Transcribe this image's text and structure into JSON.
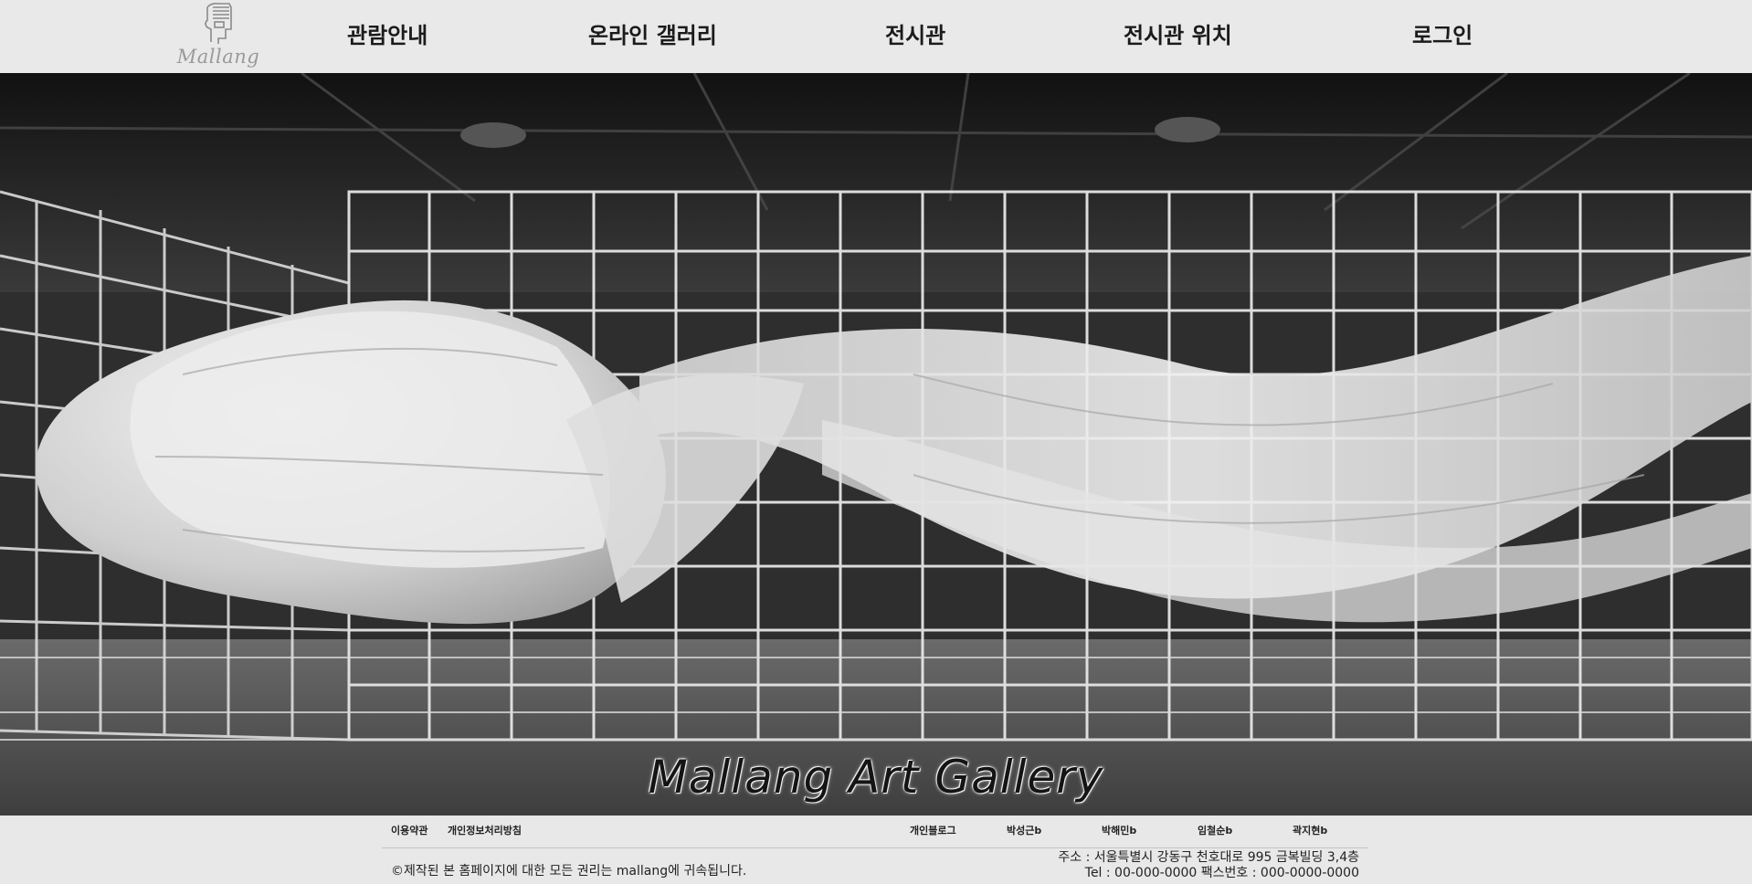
{
  "header": {
    "logo_text": "Mallang",
    "nav": [
      {
        "label": "관람안내"
      },
      {
        "label": "온라인 갤러리"
      },
      {
        "label": "전시관"
      },
      {
        "label": "전시관 위치"
      },
      {
        "label": "로그인"
      }
    ]
  },
  "hero": {
    "title": "Mallang Art Gallery"
  },
  "footer": {
    "left_links": [
      "이용약관",
      "개인정보처리방침"
    ],
    "right_links": [
      "개인블로그",
      "박성근b",
      "박해민b",
      "임철순b",
      "곽지현b"
    ],
    "copyright": "©제작된 본 홈페이지에 대한 모든 권리는 mallang에 귀속됩니다.",
    "address": "주소 : 서울특별시 강동구 천호대로 995 금복빌딩 3,4층",
    "contact": "Tel : 00-000-0000 팩스번호 : 000-0000-0000"
  },
  "colors": {
    "header_bg": "#e9e9e9",
    "footer_bg": "#e8e8e8",
    "text": "#1b1b1b"
  }
}
